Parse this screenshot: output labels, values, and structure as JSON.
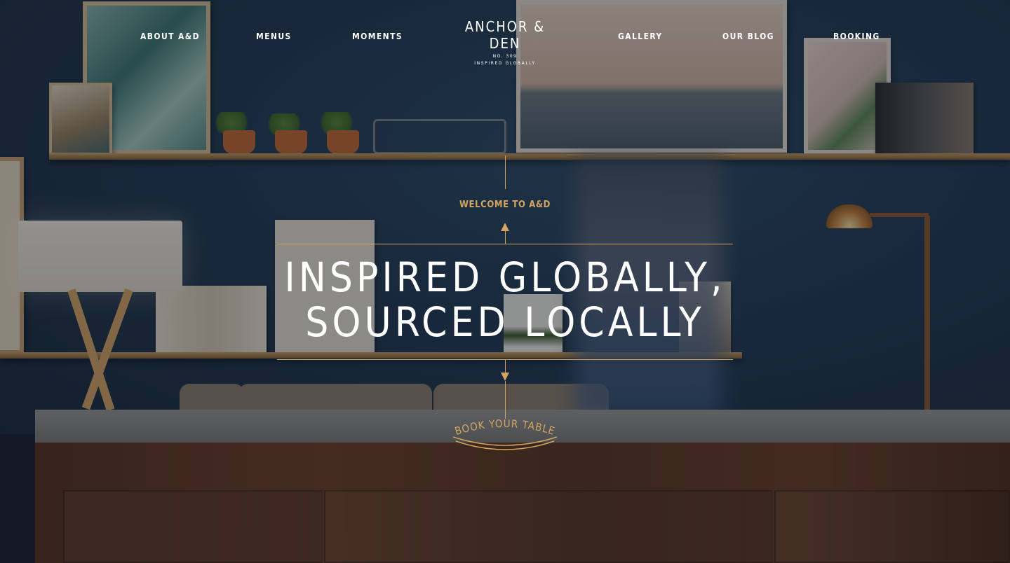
{
  "nav": {
    "left": [
      "ABOUT A&D",
      "MENUS",
      "MOMENTS"
    ],
    "right": [
      "GALLERY",
      "OUR BLOG",
      "BOOKING"
    ]
  },
  "logo": {
    "name": "ANCHOR & DEN",
    "number": "NO. 309",
    "tagline": "INSPIRED GLOBALLY"
  },
  "hero": {
    "eyebrow": "WELCOME TO A&D",
    "headline_line1": "INSPIRED GLOBALLY,",
    "headline_line2": "SOURCED LOCALLY",
    "cta": "BOOK YOUR TABLE"
  },
  "colors": {
    "accent_gold": "#d3a560",
    "text_white": "#ffffff"
  },
  "icons": [
    "arrow-up-icon",
    "arrow-down-icon"
  ]
}
